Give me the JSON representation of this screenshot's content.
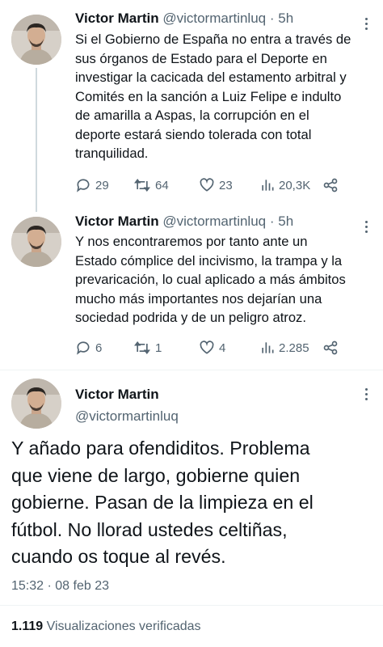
{
  "tweets": [
    {
      "name": "Victor Martin",
      "handle": "@victormartinluq",
      "dot": "·",
      "time": "5h",
      "text": "Si el Gobierno de España no entra a través de\nsus órganos de Estado para el Deporte en\ninvestigar la cacicada del estamento arbitral y\nComités en la sanción a Luiz Felipe e indulto\nde amarilla a Aspas, la corrupción en el\ndeporte estará siendo tolerada con total\ntranquilidad.",
      "replies": "29",
      "retweets": "64",
      "likes": "23",
      "views": "20,3K"
    },
    {
      "name": "Victor Martin",
      "handle": "@victormartinluq",
      "dot": "·",
      "time": "5h",
      "text": "Y nos encontraremos por tanto ante un\nEstado cómplice del incivismo, la trampa y la\nprevaricación, lo cual aplicado a más ámbitos\nmucho más importantes nos dejarían una\nsociedad podrida y de un peligro atroz.",
      "replies": "6",
      "retweets": "1",
      "likes": "4",
      "views": "2.285"
    }
  ],
  "main_tweet": {
    "name": "Victor Martin",
    "handle": "@victormartinluq",
    "text": "Y añado para ofendiditos. Problema\nque viene de largo, gobierne quien\ngobierne. Pasan de la limpieza en el\nfútbol. No llorad ustedes celtiñas,\ncuando os toque al revés.",
    "timestamp": "15:32 · 08 feb 23",
    "views_count": "1.119",
    "views_label": "Visualizaciones verificadas"
  },
  "icons": {
    "reply": "reply-icon",
    "retweet": "retweet-icon",
    "like": "heart-icon",
    "views": "views-icon",
    "share": "share-icon",
    "more": "more-icon"
  },
  "colors": {
    "text": "#0f1419",
    "secondary": "#536471",
    "divider": "#eff3f4",
    "thread_line": "#cfd9de"
  }
}
